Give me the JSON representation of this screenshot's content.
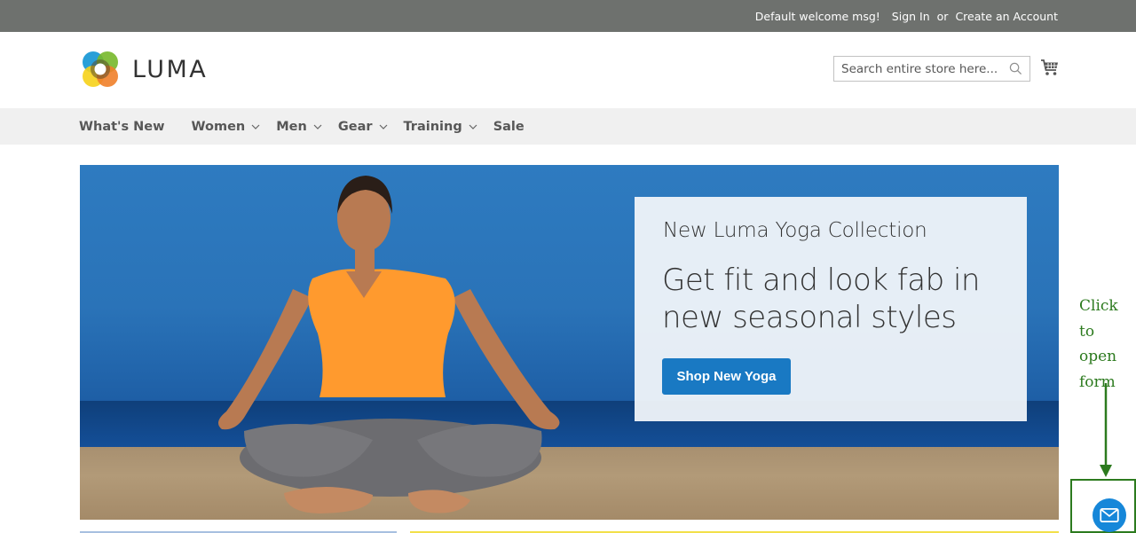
{
  "topbar": {
    "welcome": "Default welcome msg!",
    "sign_in": "Sign In",
    "or": "or",
    "create_account": "Create an Account"
  },
  "header": {
    "logo_text": "LUMA",
    "search_placeholder": "Search entire store here...",
    "search_icon": "magnifier-icon",
    "cart_icon": "shopping-cart-icon"
  },
  "nav": {
    "items": [
      {
        "label": "What's New",
        "has_submenu": false
      },
      {
        "label": "Women",
        "has_submenu": true
      },
      {
        "label": "Men",
        "has_submenu": true
      },
      {
        "label": "Gear",
        "has_submenu": true
      },
      {
        "label": "Training",
        "has_submenu": true
      },
      {
        "label": "Sale",
        "has_submenu": false
      }
    ]
  },
  "hero": {
    "image_alt": "Woman meditating in lotus pose on a beach wearing an orange top",
    "subtitle": "New Luma Yoga Collection",
    "headline": "Get fit and look fab in new seasonal styles",
    "button_label": "Shop New Yoga"
  },
  "annotation": {
    "text_line1": "Click to",
    "text_line2": "open",
    "text_line3": "form",
    "color": "#2c7a1e"
  },
  "widget": {
    "icon": "envelope-icon",
    "color": "#1687d9"
  },
  "colors": {
    "topbar_bg": "#6e716e",
    "nav_bg": "#f0f0f0",
    "primary_button": "#1979c3"
  }
}
